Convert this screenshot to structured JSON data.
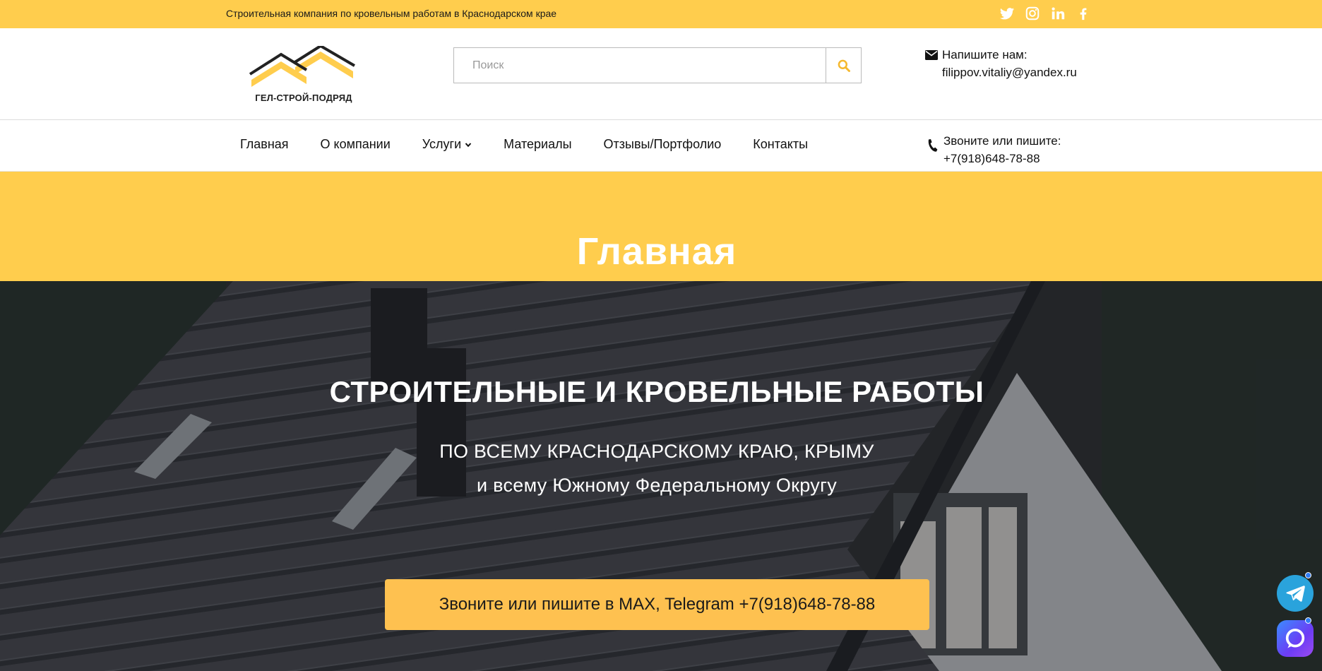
{
  "topbar": {
    "tagline": "Строительная компания по кровельным работам в Краснодарском крае",
    "socials": [
      "twitter-icon",
      "instagram-icon",
      "linkedin-icon",
      "facebook-icon"
    ]
  },
  "header": {
    "logo_text": "ГЕЛ-СТРОЙ-ПОДРЯД",
    "search_placeholder": "Поиск",
    "mail_label": "Напишите нам:",
    "mail_value": "filippov.vitaliy@yandex.ru"
  },
  "nav": {
    "items": [
      {
        "label": "Главная"
      },
      {
        "label": "О компании"
      },
      {
        "label": "Услуги"
      },
      {
        "label": "Материалы"
      },
      {
        "label": "Отзывы/Портфолио"
      },
      {
        "label": "Контакты"
      }
    ],
    "phone_label": "Звоните или пишите:",
    "phone_value": "+7(918)648-78-88"
  },
  "band": {
    "title": "Главная"
  },
  "hero": {
    "title": "СТРОИТЕЛЬНЫЕ И КРОВЕЛЬНЫЕ РАБОТЫ",
    "subtitle_line1": "ПО ВСЕМУ КРАСНОДАРСКОМУ КРАЮ, КРЫМУ",
    "subtitle_line2": "и всему Южному Федеральному Округу",
    "cta_label": "Звоните или пишите в MAX, Telegram +7(918)648-78-88"
  },
  "colors": {
    "accent": "#ffcd4d",
    "cta": "#fec150",
    "telegram": "#2aa3dc"
  }
}
